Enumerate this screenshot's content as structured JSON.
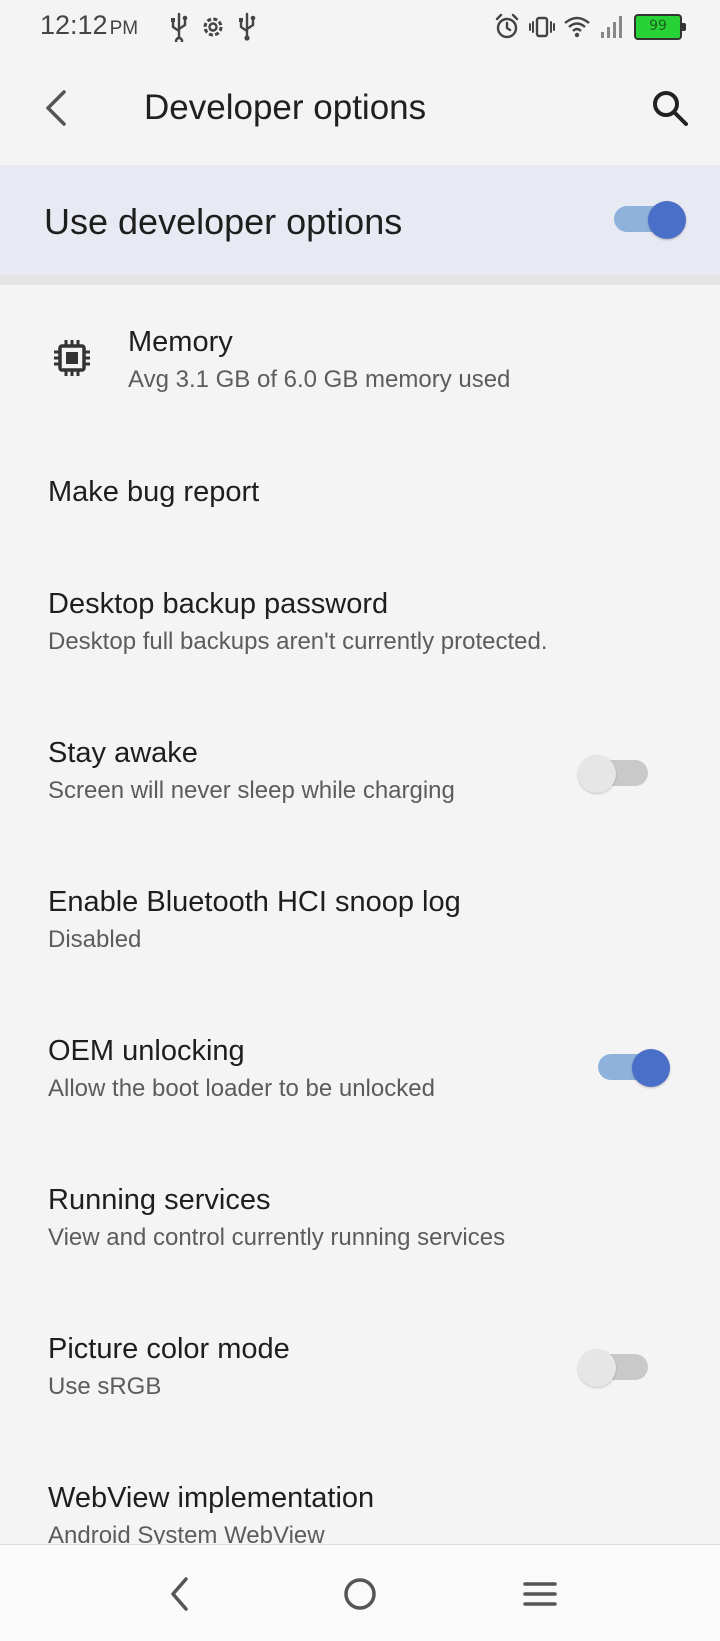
{
  "status_bar": {
    "time": "12:12",
    "ampm": "PM",
    "battery_level": "99",
    "left_icons": [
      "usb-icon",
      "settings-icon",
      "usb-icon"
    ],
    "right_icons": [
      "alarm-icon",
      "vibrate-icon",
      "wifi-icon",
      "signal-icon",
      "battery-icon"
    ]
  },
  "app_bar": {
    "title": "Developer options"
  },
  "master_toggle": {
    "label": "Use developer options",
    "checked": true
  },
  "items": [
    {
      "title": "Memory",
      "subtitle": "Avg 3.1 GB of 6.0 GB memory used",
      "icon": "memory-chip-icon"
    },
    {
      "title": "Make bug report"
    },
    {
      "title": "Desktop backup password",
      "subtitle": "Desktop full backups aren't currently protected."
    },
    {
      "title": "Stay awake",
      "subtitle": "Screen will never sleep while charging",
      "toggle": false
    },
    {
      "title": "Enable Bluetooth HCI snoop log",
      "subtitle": "Disabled"
    },
    {
      "title": "OEM unlocking",
      "subtitle": "Allow the boot loader to be unlocked",
      "toggle": true
    },
    {
      "title": "Running services",
      "subtitle": "View and control currently running services"
    },
    {
      "title": "Picture color mode",
      "subtitle": "Use sRGB",
      "toggle": false
    },
    {
      "title": "WebView implementation",
      "subtitle": "Android System WebView"
    }
  ],
  "nav_bar": {
    "buttons": [
      "back-icon",
      "home-icon",
      "recents-menu-icon"
    ]
  },
  "colors": {
    "accent": "#4a6fc8",
    "accent_track": "#8fb2dc",
    "master_bg": "#e8eaf3",
    "battery_fill": "#27d236"
  }
}
